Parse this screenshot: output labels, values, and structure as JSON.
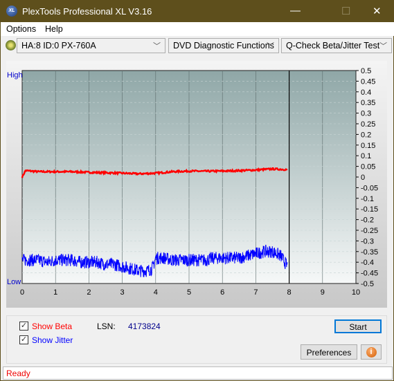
{
  "window": {
    "title": "PlexTools Professional XL V3.16",
    "logo_text": "XL"
  },
  "menu": [
    "Options",
    "Help"
  ],
  "toolbar": {
    "drive": "HA:8 ID:0  PX-760A",
    "function": "DVD Diagnostic Functions",
    "test": "Q-Check Beta/Jitter Test"
  },
  "chart_data": {
    "type": "line",
    "left_labels": {
      "top": "High",
      "bottom": "Low"
    },
    "xlim": [
      0,
      10
    ],
    "ylim": [
      -0.5,
      0.5
    ],
    "x_ticks": [
      "0",
      "1",
      "2",
      "3",
      "4",
      "5",
      "6",
      "7",
      "8",
      "9",
      "10"
    ],
    "y_ticks": [
      "0.5",
      "0.45",
      "0.4",
      "0.35",
      "0.3",
      "0.25",
      "0.2",
      "0.15",
      "0.1",
      "0.05",
      "0",
      "-0.05",
      "-0.1",
      "-0.15",
      "-0.2",
      "-0.25",
      "-0.3",
      "-0.35",
      "-0.4",
      "-0.45",
      "-0.5"
    ],
    "grid": true,
    "end_marker_x": 8,
    "colors": {
      "beta": "#ff0000",
      "jitter": "#0000ff"
    },
    "series": [
      {
        "key": "beta",
        "x": [
          0,
          0.1,
          0.5,
          1,
          1.5,
          2,
          2.5,
          3,
          3.5,
          4,
          4.5,
          5,
          5.5,
          6,
          6.5,
          7,
          7.5,
          7.95
        ],
        "y": [
          0.0,
          0.03,
          0.025,
          0.025,
          0.025,
          0.022,
          0.02,
          0.018,
          0.015,
          0.018,
          0.025,
          0.028,
          0.027,
          0.028,
          0.03,
          0.033,
          0.038,
          0.035
        ]
      },
      {
        "key": "jitter",
        "x": [
          0,
          0.25,
          0.5,
          0.75,
          1,
          1.25,
          1.5,
          1.75,
          2,
          2.25,
          2.5,
          2.75,
          3,
          3.25,
          3.5,
          3.75,
          3.9,
          4.0,
          4.25,
          4.5,
          4.75,
          5,
          5.25,
          5.5,
          5.75,
          6,
          6.25,
          6.5,
          6.75,
          7,
          7.25,
          7.5,
          7.75,
          7.95
        ],
        "y": [
          -0.39,
          -0.39,
          -0.39,
          -0.4,
          -0.39,
          -0.39,
          -0.39,
          -0.4,
          -0.4,
          -0.4,
          -0.41,
          -0.41,
          -0.42,
          -0.43,
          -0.44,
          -0.44,
          -0.43,
          -0.38,
          -0.38,
          -0.39,
          -0.39,
          -0.39,
          -0.39,
          -0.39,
          -0.38,
          -0.38,
          -0.38,
          -0.38,
          -0.37,
          -0.36,
          -0.35,
          -0.35,
          -0.37,
          -0.42
        ]
      }
    ]
  },
  "controls": {
    "show_beta": "Show Beta",
    "show_jitter": "Show Jitter",
    "beta_checked": true,
    "jitter_checked": true,
    "lsn_label": "LSN:",
    "lsn_value": "4173824",
    "start": "Start",
    "preferences": "Preferences"
  },
  "status": "Ready"
}
